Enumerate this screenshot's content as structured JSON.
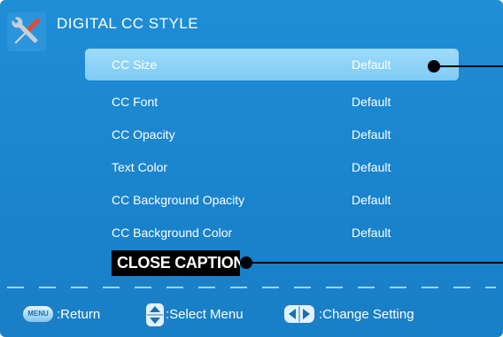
{
  "header": {
    "title": "DIGITAL CC STYLE",
    "icon": "tools-icon"
  },
  "menu": {
    "items": [
      {
        "label": "CC Size",
        "value": "Default",
        "selected": true
      },
      {
        "label": "CC Font",
        "value": "Default"
      },
      {
        "label": "CC Opacity",
        "value": "Default"
      },
      {
        "label": "Text Color",
        "value": "Default"
      },
      {
        "label": "CC Background Opacity",
        "value": "Default"
      },
      {
        "label": "CC Background Color",
        "value": "Default"
      }
    ]
  },
  "preview": {
    "text": "CLOSE CAPTION"
  },
  "footer": {
    "menu_key": "MENU",
    "return_label": ":Return",
    "select_label": ":Select Menu",
    "change_label": ":Change Setting"
  },
  "colors": {
    "background": "#1a83cc",
    "highlight": "#8fd3f7",
    "text": "#ffffff",
    "caption_background": "#000000"
  }
}
